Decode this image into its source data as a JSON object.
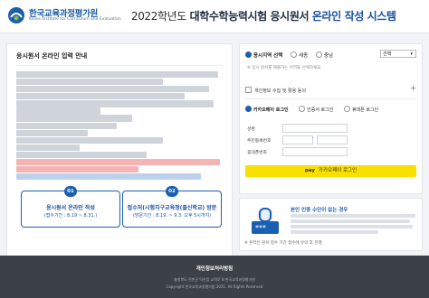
{
  "header": {
    "logo_ko": "한국교육과정평가원",
    "logo_en": "Korea Institute for Curriculum and Evaluation",
    "title_year": "2022학년도",
    "title_name": "대학수학능력시험 응시원서",
    "title_online": "온라인 작성 시스템"
  },
  "left": {
    "heading": "응시원서 온라인 입력 안내",
    "steps": [
      {
        "num": "01",
        "title": "응시원서 온라인 작성",
        "sub": "(접수기간 : 8.19 ~ 8.31.)"
      },
      {
        "num": "02",
        "title": "접수처(시험지구교육청(출신학교) 방문",
        "sub": "(방문기간 : 8.19. ~ 9.3. 오후 5시까지)"
      }
    ]
  },
  "right": {
    "region_label": "응시지역 선택",
    "regions": [
      "세종",
      "충남"
    ],
    "select_value": "선택",
    "region_note": "※ 응시 원서를 제출하는 지역을 선택하세요.",
    "consent_label": "개인정보 수집 및 활용 동의",
    "login_tabs": [
      "카카오페이 로그인",
      "인증서 로그인",
      "휴대폰 로그인"
    ],
    "form_labels": [
      "성명",
      "주민등록번호",
      "휴대폰번호"
    ],
    "kakao_pay": "pay",
    "kakao_button": "카카오페이 로그인"
  },
  "notice": {
    "title": "본인 인증 수단이 없는 경우",
    "note": "※ 온라인 원서 접수 기간 접수에 유의 후 진행"
  },
  "footer": {
    "name": "개인정보처리방침",
    "address": "충청북도 진천군 덕산읍 교학로 8 한국교육과정평가원",
    "copyright": "Copyright 한국교육과정평가원 2021. All Rights Reserved"
  },
  "colors": {
    "brand": "#1b5fb3",
    "kakao": "#f9e000",
    "footer": "#3c4048"
  }
}
